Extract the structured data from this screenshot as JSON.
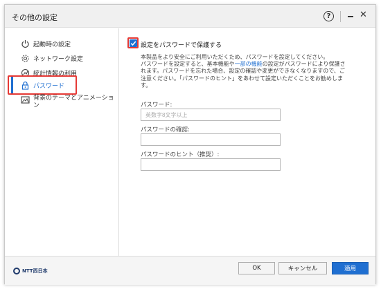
{
  "window": {
    "title": "その他の設定",
    "help_label": "?"
  },
  "sidebar": {
    "items": [
      {
        "label": "起動時の設定",
        "icon": "power-icon"
      },
      {
        "label": "ネットワーク設定",
        "icon": "gear-icon"
      },
      {
        "label": "統計情報の利用",
        "icon": "stats-icon"
      },
      {
        "label": "パスワード",
        "icon": "lock-icon",
        "active": true
      },
      {
        "label": "背景のテーマとアニメーション",
        "icon": "picture-icon"
      }
    ]
  },
  "content": {
    "checkbox_label": "設定をパスワードで保護する",
    "checked": true,
    "description_lines": [
      "本製品をより安全にご利用いただくため、パスワードを設定してください。",
      "パスワードを設定すると、基本機能や一部の機能の設定がパスワードにより保護さ",
      "れます。パスワードを忘れた場合、設定の確認や変更ができなくなりますので、ご",
      "注意ください。「パスワードのヒント」をあわせて設定いただくことをお勧めしま",
      "す。"
    ],
    "description_link": "一部の機能",
    "password": {
      "label": "パスワード:",
      "placeholder": "英数字8文字以上",
      "value": ""
    },
    "confirm": {
      "label": "パスワードの確認:",
      "value": ""
    },
    "hint": {
      "label": "パスワードのヒント（推奨）:",
      "value": ""
    }
  },
  "footer": {
    "logo_text": "NTT西日本",
    "ok_label": "OK",
    "cancel_label": "キャンセル",
    "apply_label": "適用"
  },
  "colors": {
    "accent": "#1f6fd1",
    "highlight": "#e53935"
  }
}
